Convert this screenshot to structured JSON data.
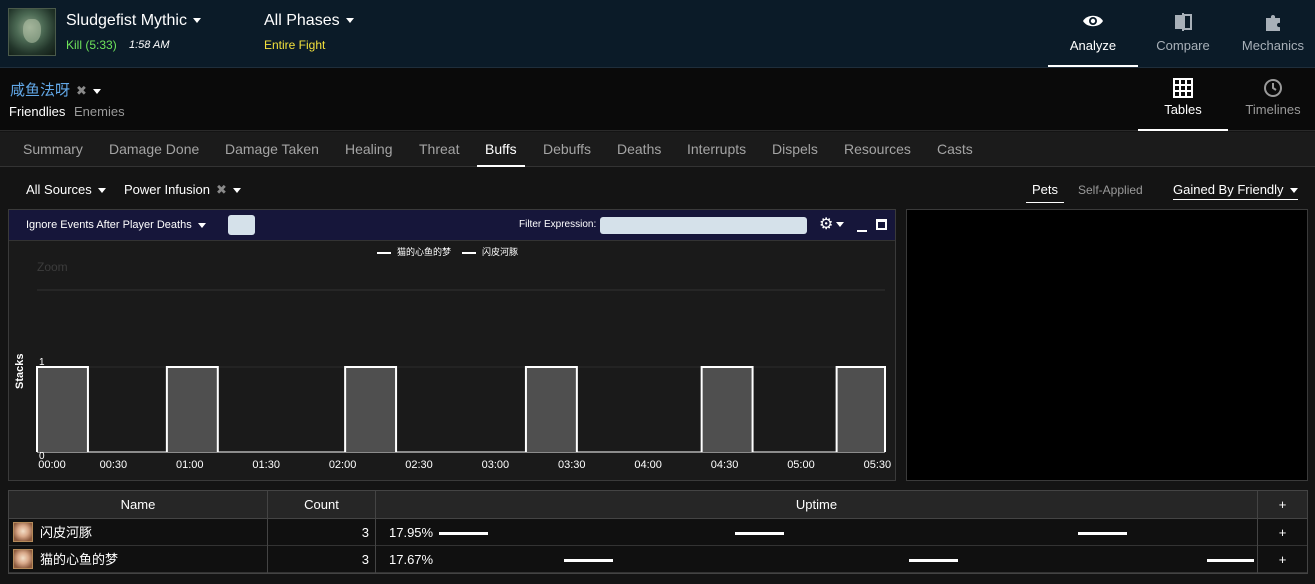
{
  "header": {
    "boss_name": "Sludgefist Mythic",
    "kill_result": "Kill (5:33)",
    "kill_time": "1:58 AM",
    "phase": "All Phases",
    "phase_sub": "Entire Fight",
    "nav": [
      {
        "label": "Analyze",
        "icon": "eye-icon",
        "active": true
      },
      {
        "label": "Compare",
        "icon": "compare-icon",
        "active": false
      },
      {
        "label": "Mechanics",
        "icon": "puzzle-icon",
        "active": false
      }
    ]
  },
  "player": {
    "name": "咸鱼法呀",
    "friendlies": "Friendlies",
    "enemies": "Enemies",
    "views": [
      {
        "label": "Tables",
        "icon": "grid-icon",
        "active": true
      },
      {
        "label": "Timelines",
        "icon": "clock-icon",
        "active": false
      }
    ]
  },
  "tabs": [
    "Summary",
    "Damage Done",
    "Damage Taken",
    "Healing",
    "Threat",
    "Buffs",
    "Debuffs",
    "Deaths",
    "Interrupts",
    "Dispels",
    "Resources",
    "Casts"
  ],
  "active_tab": "Buffs",
  "filters": {
    "source": "All Sources",
    "ability": "Power Infusion",
    "pets": "Pets",
    "self_applied": "Self-Applied",
    "gained_by": "Gained By Friendly"
  },
  "chart_toolbar": {
    "ignore_events": "Ignore Events After Player Deaths",
    "filter_label": "Filter Expression:",
    "filter_value": ""
  },
  "chart_data": {
    "type": "area",
    "ylabel": "Stacks",
    "xlabel": "",
    "zoom_label": "Zoom",
    "ylim": [
      0,
      1
    ],
    "yticks": [
      "0",
      "1"
    ],
    "xlim_seconds": [
      0,
      333
    ],
    "xticks": [
      "00:00",
      "00:30",
      "01:00",
      "01:30",
      "02:00",
      "02:30",
      "03:00",
      "03:30",
      "04:00",
      "04:30",
      "05:00",
      "05:30"
    ],
    "series": [
      {
        "name": "猫的心鱼的梦",
        "color": "#ffffff"
      },
      {
        "name": "闪皮河豚",
        "color": "#ffffff"
      }
    ],
    "intervals_seconds": [
      [
        0,
        20
      ],
      [
        51,
        71
      ],
      [
        121,
        141
      ],
      [
        192,
        212
      ],
      [
        261,
        281
      ],
      [
        314,
        333
      ]
    ],
    "value_when_active": 1
  },
  "table": {
    "columns": [
      "Name",
      "Count",
      "Uptime",
      "+"
    ],
    "rows": [
      {
        "name": "闪皮河豚",
        "count": "3",
        "uptime": "17.95%",
        "plus": "+",
        "segments_seconds": [
          [
            0,
            20
          ],
          [
            121,
            141
          ],
          [
            261,
            281
          ]
        ]
      },
      {
        "name": "猫的心鱼的梦",
        "count": "3",
        "uptime": "17.67%",
        "plus": "+",
        "segments_seconds": [
          [
            51,
            71
          ],
          [
            192,
            212
          ],
          [
            314,
            333
          ]
        ]
      }
    ]
  }
}
